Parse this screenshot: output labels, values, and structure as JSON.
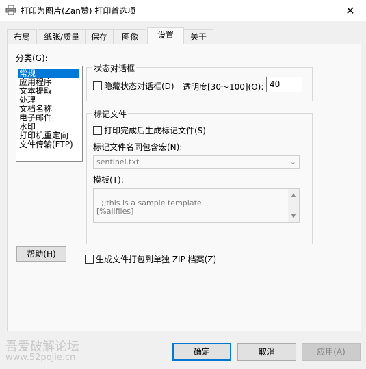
{
  "window": {
    "title": "打印为图片(Zan赞) 打印首选项",
    "close_glyph": "✕"
  },
  "tabs": [
    {
      "label": "布局"
    },
    {
      "label": "纸张/质量"
    },
    {
      "label": "保存"
    },
    {
      "label": "图像"
    },
    {
      "label": "设置",
      "active": true
    },
    {
      "label": "关于"
    }
  ],
  "category": {
    "label": "分类(G):",
    "items": [
      "常规",
      "应用程序",
      "文本提取",
      "处理",
      "文档名称",
      "电子邮件",
      "水印",
      "打印机重定向",
      "文件传输(FTP)"
    ],
    "selected_index": 0
  },
  "status_dialog": {
    "group_title": "状态对话框",
    "hide_label": "隐藏状态对话框(D)",
    "hide_checked": false,
    "transparency_label": "透明度[30～100](O):",
    "transparency_value": "40"
  },
  "marker_file": {
    "group_title": "标记文件",
    "generate_label": "打印完成后生成标记文件(S)",
    "generate_checked": false,
    "name_macro_label": "标记文件名同包含宏(N):",
    "name_value": "sentinel.txt",
    "template_label": "模板(T):",
    "template_text": ";;this is a sample template\n[%allfiles]"
  },
  "zip_option": {
    "label": "生成文件打包到单独 ZIP 档案(Z)",
    "checked": false
  },
  "buttons": {
    "help": "帮助(H)",
    "ok": "确定",
    "cancel": "取消",
    "apply": "应用(A)"
  },
  "watermark": {
    "line1": "吾爱破解论坛",
    "line2": "www.52pojie.cn"
  }
}
